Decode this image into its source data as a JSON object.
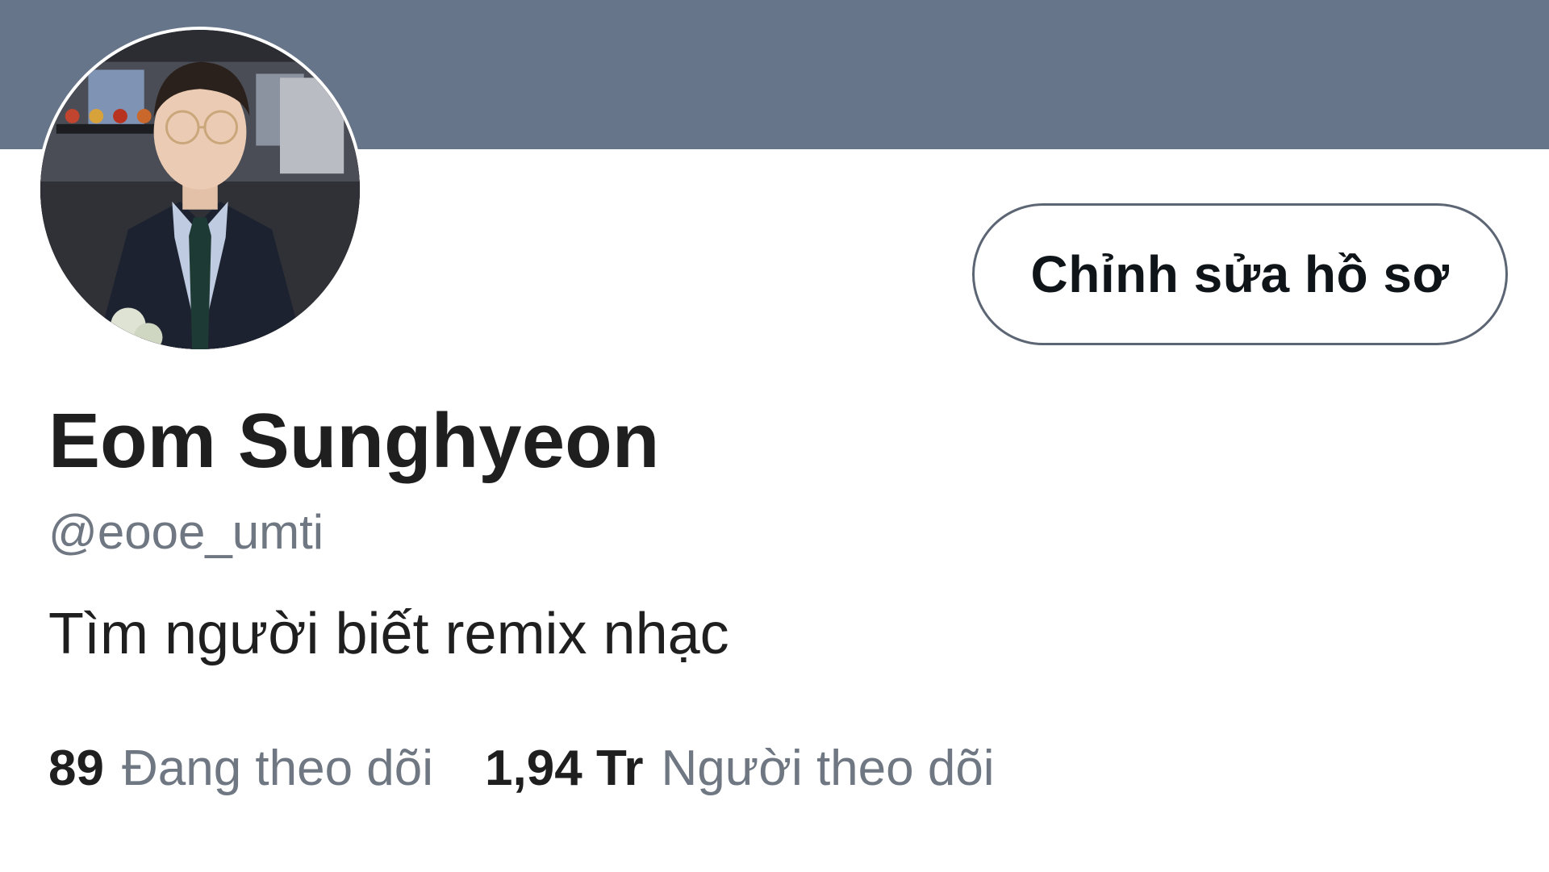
{
  "colors": {
    "banner": "#66758a",
    "text_primary": "#1f1f1f",
    "text_secondary": "#6f7782",
    "button_border": "#5b6573"
  },
  "profile": {
    "display_name": "Eom Sunghyeon",
    "handle": "@eooe_umti",
    "bio": "Tìm người biết remix nhạc",
    "avatar_icon": "profile-photo"
  },
  "actions": {
    "edit_profile_label": "Chỉnh sửa hồ sơ"
  },
  "stats": {
    "following_count": "89",
    "following_label": "Đang theo dõi",
    "followers_count": "1,94 Tr",
    "followers_label": "Người theo dõi"
  }
}
